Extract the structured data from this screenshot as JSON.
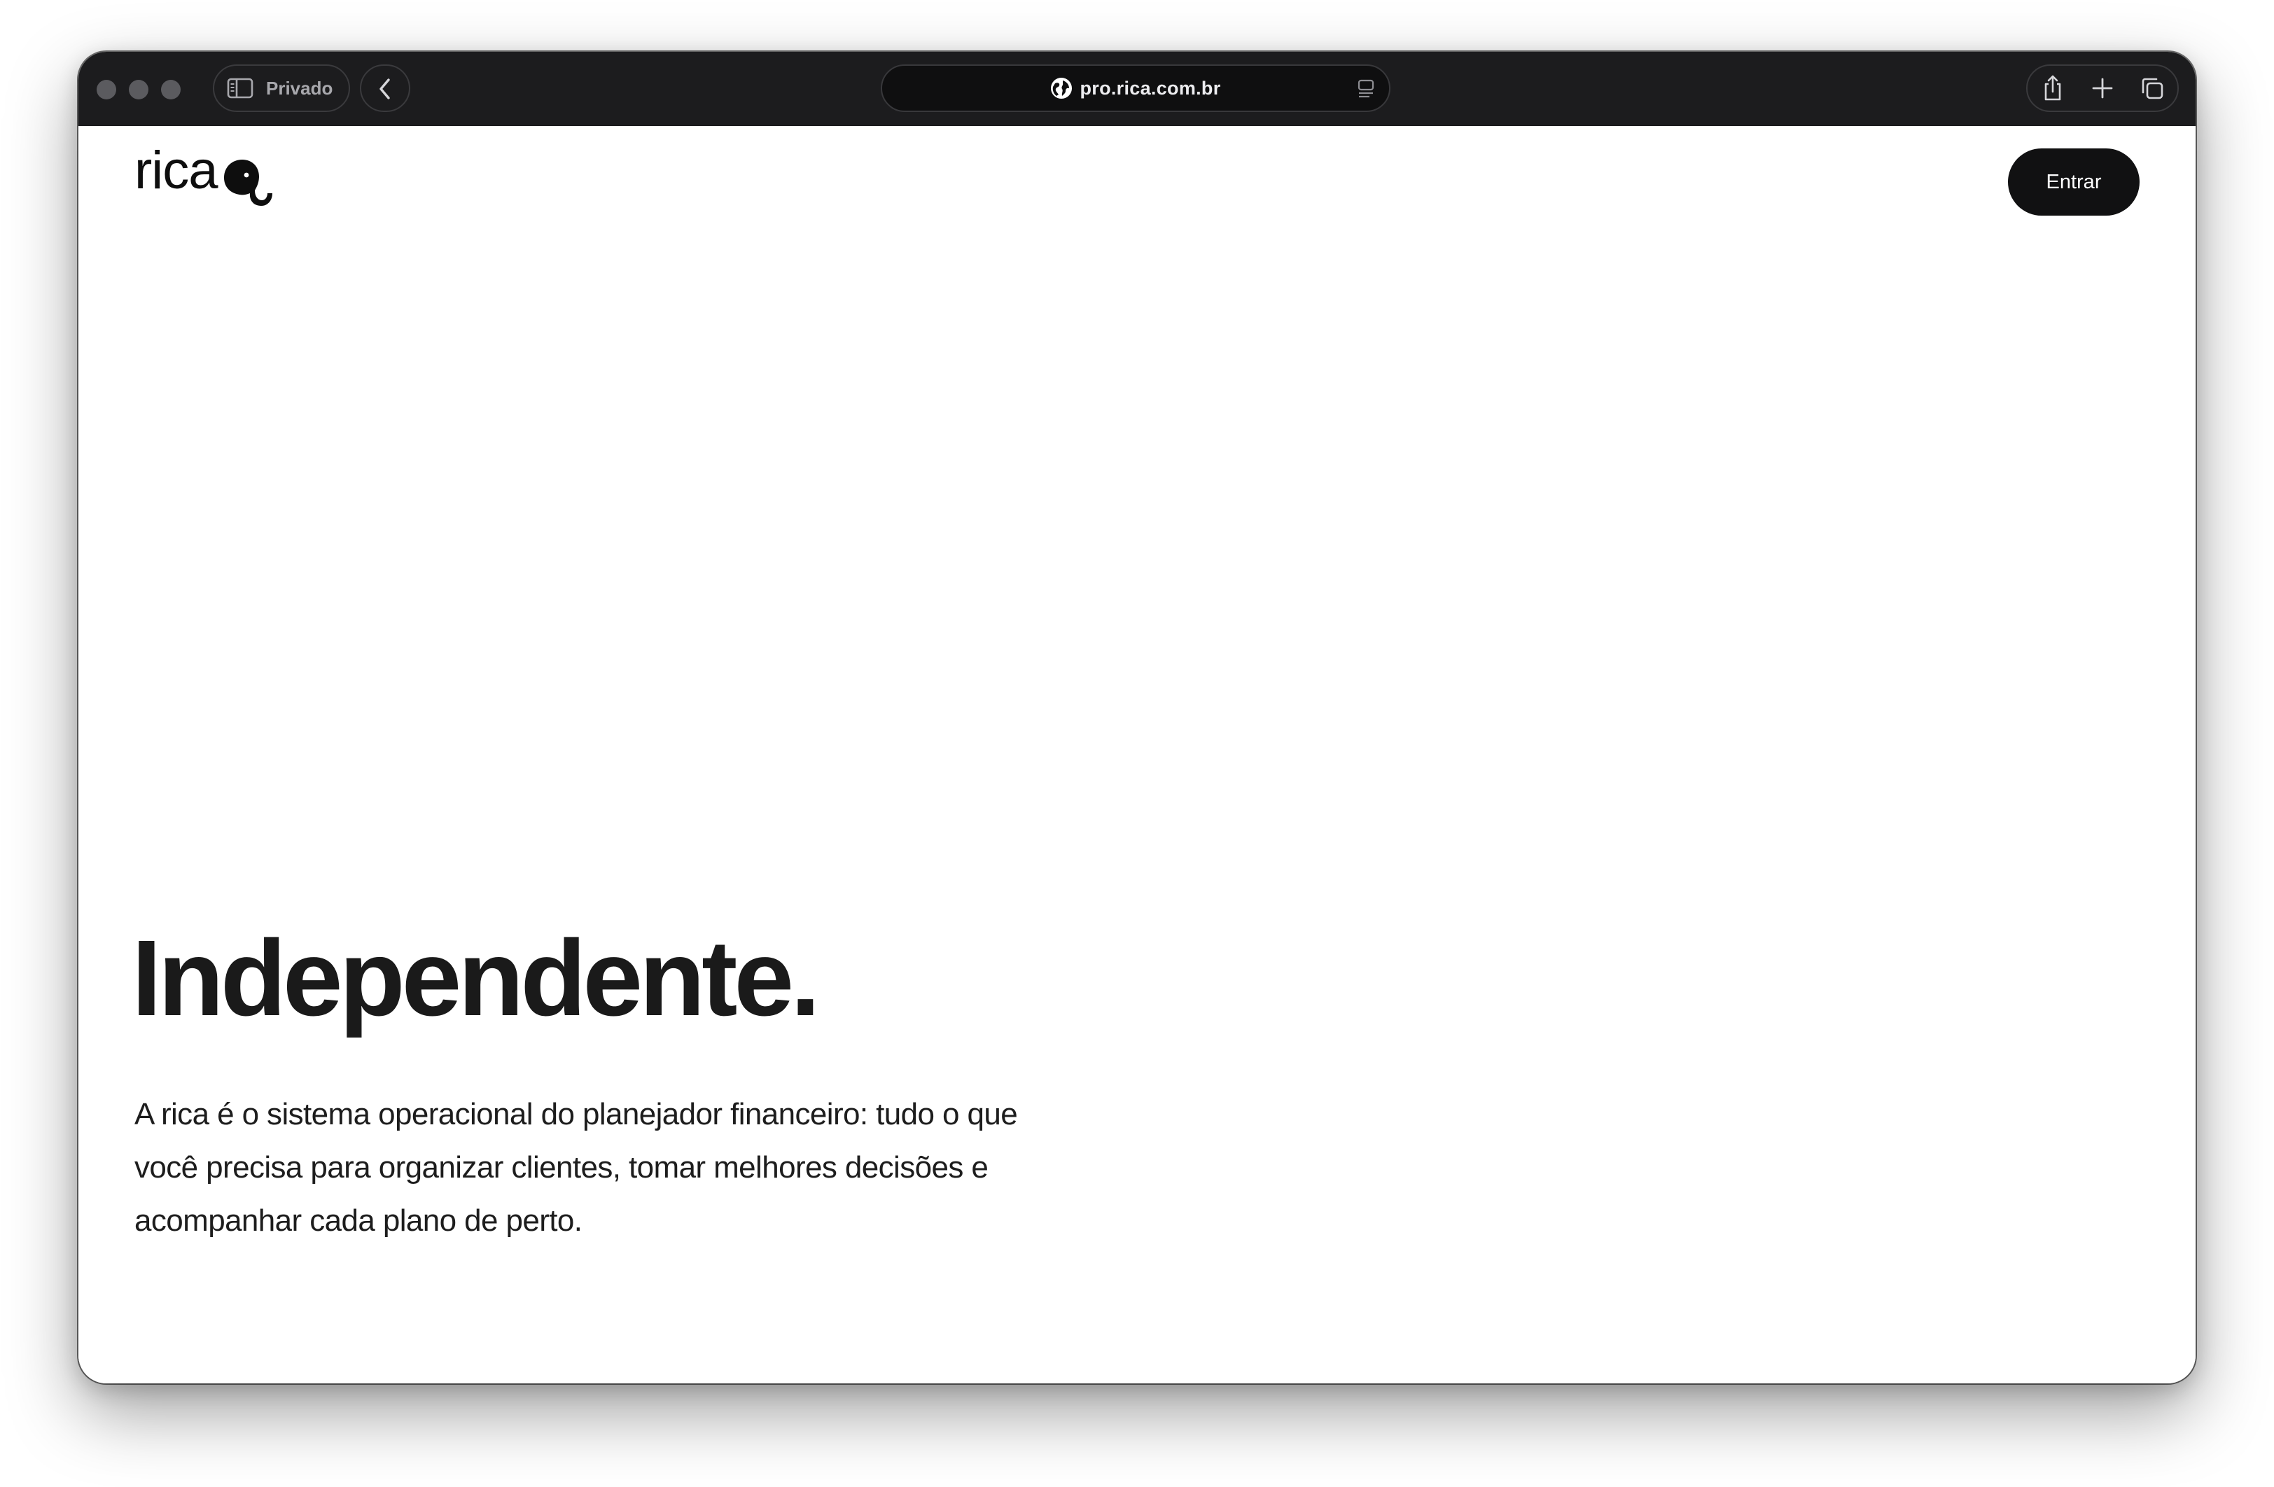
{
  "browser": {
    "mode_label": "Privado",
    "url": "pro.rica.com.br",
    "icons": {
      "sidebar": "sidebar-icon",
      "back": "chevron-left-icon",
      "site": "globe-icon",
      "reader": "reader-icon",
      "share": "share-icon",
      "new_tab": "plus-icon",
      "tabs": "tabs-overview-icon"
    }
  },
  "header": {
    "logo_text": "rica",
    "login_label": "Entrar"
  },
  "hero": {
    "title": "Independente.",
    "description": "A rica é o sistema operacional do planejador financeiro: tudo o que você precisa para organizar clientes, tomar melhores decisões e acompanhar cada plano de perto."
  },
  "colors": {
    "titlebar": "#1c1c1e",
    "button_bg": "#111112",
    "text": "#1a1a1a"
  }
}
